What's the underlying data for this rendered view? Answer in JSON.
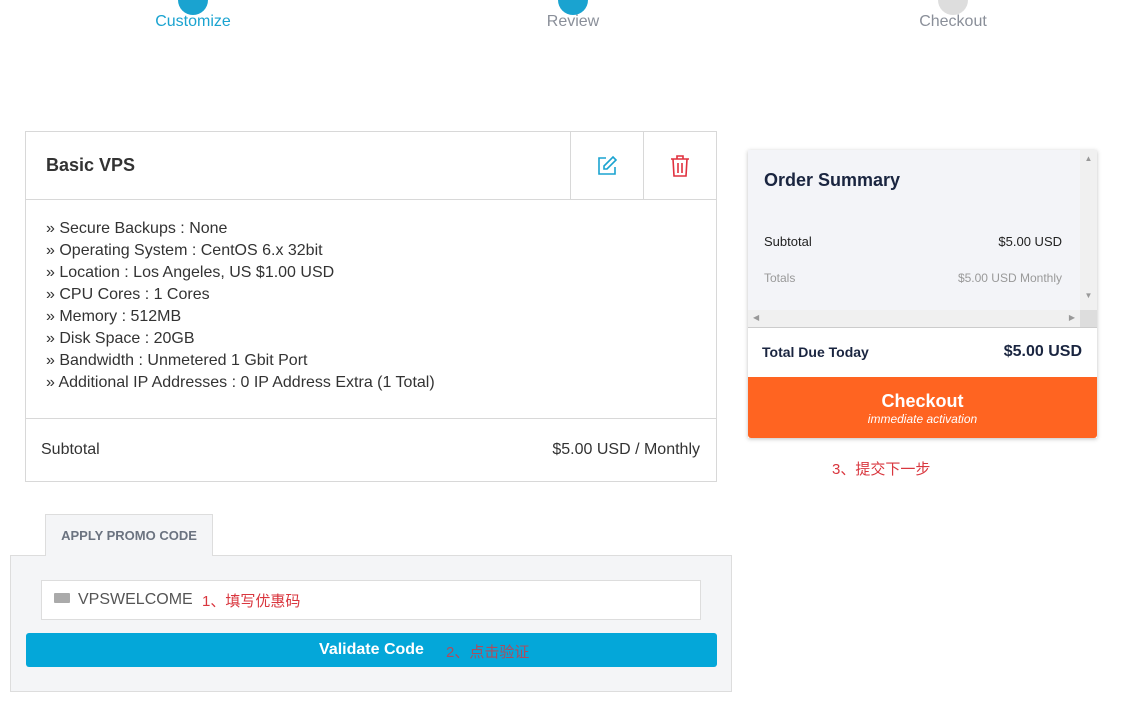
{
  "steps": [
    {
      "label": "Customize",
      "color": "#1aa3d0"
    },
    {
      "label": "Review",
      "color": "#8a8f99"
    },
    {
      "label": "Checkout",
      "color": "#8a8f99"
    }
  ],
  "product": {
    "title": "Basic VPS",
    "edit_icon": "edit-icon",
    "delete_icon": "trash-icon",
    "specs": [
      "» Secure Backups : None",
      "» Operating System : CentOS 6.x 32bit",
      "» Location : Los Angeles, US $1.00 USD",
      "» CPU Cores : 1 Cores",
      "» Memory : 512MB",
      "» Disk Space : 20GB",
      "» Bandwidth : Unmetered 1 Gbit Port",
      "» Additional IP Addresses : 0 IP Address Extra (1 Total)"
    ],
    "subtotal_label": "Subtotal",
    "subtotal_value": "$5.00 USD / Monthly"
  },
  "promo": {
    "tab_label": "APPLY PROMO CODE",
    "input_value": "VPSWELCOME",
    "note1": "1、填写优惠码",
    "validate_label": "Validate Code",
    "note2": "2、点击验证"
  },
  "summary": {
    "title": "Order Summary",
    "subtotal_label": "Subtotal",
    "subtotal_value": "$5.00 USD",
    "totals_label": "Totals",
    "totals_value": "$5.00 USD Monthly",
    "due_label": "Total Due Today",
    "due_value": "$5.00 USD",
    "checkout_label": "Checkout",
    "checkout_sub": "immediate activation",
    "note3": "3、提交下一步",
    "checkout_color": "#ff6421"
  }
}
